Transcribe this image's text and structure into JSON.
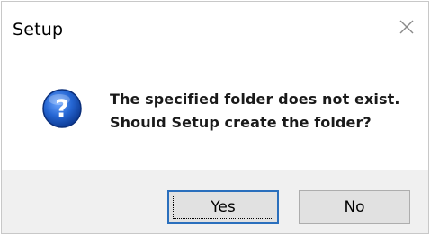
{
  "window": {
    "title": "Setup",
    "close_icon": "close-icon"
  },
  "message": {
    "icon": "question-icon",
    "line1": "The specified folder does not exist.",
    "line2": "Should Setup create the folder?"
  },
  "buttons": {
    "yes": {
      "mnemonic": "Y",
      "rest": "es"
    },
    "no": {
      "mnemonic": "N",
      "rest": "o"
    }
  },
  "colors": {
    "icon_blue": "#1f5fbf",
    "default_button_border": "#2a6fbd",
    "footer_background": "#f0f0f0"
  }
}
